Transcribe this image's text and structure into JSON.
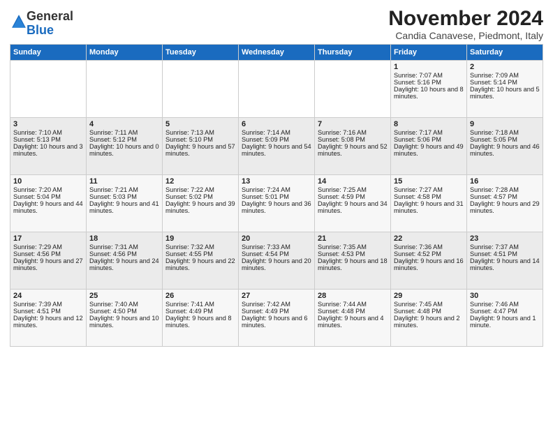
{
  "logo": {
    "general": "General",
    "blue": "Blue"
  },
  "title": "November 2024",
  "subtitle": "Candia Canavese, Piedmont, Italy",
  "weekdays": [
    "Sunday",
    "Monday",
    "Tuesday",
    "Wednesday",
    "Thursday",
    "Friday",
    "Saturday"
  ],
  "weeks": [
    [
      {
        "day": "",
        "info": ""
      },
      {
        "day": "",
        "info": ""
      },
      {
        "day": "",
        "info": ""
      },
      {
        "day": "",
        "info": ""
      },
      {
        "day": "",
        "info": ""
      },
      {
        "day": "1",
        "info": "Sunrise: 7:07 AM\nSunset: 5:16 PM\nDaylight: 10 hours and 8 minutes."
      },
      {
        "day": "2",
        "info": "Sunrise: 7:09 AM\nSunset: 5:14 PM\nDaylight: 10 hours and 5 minutes."
      }
    ],
    [
      {
        "day": "3",
        "info": "Sunrise: 7:10 AM\nSunset: 5:13 PM\nDaylight: 10 hours and 3 minutes."
      },
      {
        "day": "4",
        "info": "Sunrise: 7:11 AM\nSunset: 5:12 PM\nDaylight: 10 hours and 0 minutes."
      },
      {
        "day": "5",
        "info": "Sunrise: 7:13 AM\nSunset: 5:10 PM\nDaylight: 9 hours and 57 minutes."
      },
      {
        "day": "6",
        "info": "Sunrise: 7:14 AM\nSunset: 5:09 PM\nDaylight: 9 hours and 54 minutes."
      },
      {
        "day": "7",
        "info": "Sunrise: 7:16 AM\nSunset: 5:08 PM\nDaylight: 9 hours and 52 minutes."
      },
      {
        "day": "8",
        "info": "Sunrise: 7:17 AM\nSunset: 5:06 PM\nDaylight: 9 hours and 49 minutes."
      },
      {
        "day": "9",
        "info": "Sunrise: 7:18 AM\nSunset: 5:05 PM\nDaylight: 9 hours and 46 minutes."
      }
    ],
    [
      {
        "day": "10",
        "info": "Sunrise: 7:20 AM\nSunset: 5:04 PM\nDaylight: 9 hours and 44 minutes."
      },
      {
        "day": "11",
        "info": "Sunrise: 7:21 AM\nSunset: 5:03 PM\nDaylight: 9 hours and 41 minutes."
      },
      {
        "day": "12",
        "info": "Sunrise: 7:22 AM\nSunset: 5:02 PM\nDaylight: 9 hours and 39 minutes."
      },
      {
        "day": "13",
        "info": "Sunrise: 7:24 AM\nSunset: 5:01 PM\nDaylight: 9 hours and 36 minutes."
      },
      {
        "day": "14",
        "info": "Sunrise: 7:25 AM\nSunset: 4:59 PM\nDaylight: 9 hours and 34 minutes."
      },
      {
        "day": "15",
        "info": "Sunrise: 7:27 AM\nSunset: 4:58 PM\nDaylight: 9 hours and 31 minutes."
      },
      {
        "day": "16",
        "info": "Sunrise: 7:28 AM\nSunset: 4:57 PM\nDaylight: 9 hours and 29 minutes."
      }
    ],
    [
      {
        "day": "17",
        "info": "Sunrise: 7:29 AM\nSunset: 4:56 PM\nDaylight: 9 hours and 27 minutes."
      },
      {
        "day": "18",
        "info": "Sunrise: 7:31 AM\nSunset: 4:56 PM\nDaylight: 9 hours and 24 minutes."
      },
      {
        "day": "19",
        "info": "Sunrise: 7:32 AM\nSunset: 4:55 PM\nDaylight: 9 hours and 22 minutes."
      },
      {
        "day": "20",
        "info": "Sunrise: 7:33 AM\nSunset: 4:54 PM\nDaylight: 9 hours and 20 minutes."
      },
      {
        "day": "21",
        "info": "Sunrise: 7:35 AM\nSunset: 4:53 PM\nDaylight: 9 hours and 18 minutes."
      },
      {
        "day": "22",
        "info": "Sunrise: 7:36 AM\nSunset: 4:52 PM\nDaylight: 9 hours and 16 minutes."
      },
      {
        "day": "23",
        "info": "Sunrise: 7:37 AM\nSunset: 4:51 PM\nDaylight: 9 hours and 14 minutes."
      }
    ],
    [
      {
        "day": "24",
        "info": "Sunrise: 7:39 AM\nSunset: 4:51 PM\nDaylight: 9 hours and 12 minutes."
      },
      {
        "day": "25",
        "info": "Sunrise: 7:40 AM\nSunset: 4:50 PM\nDaylight: 9 hours and 10 minutes."
      },
      {
        "day": "26",
        "info": "Sunrise: 7:41 AM\nSunset: 4:49 PM\nDaylight: 9 hours and 8 minutes."
      },
      {
        "day": "27",
        "info": "Sunrise: 7:42 AM\nSunset: 4:49 PM\nDaylight: 9 hours and 6 minutes."
      },
      {
        "day": "28",
        "info": "Sunrise: 7:44 AM\nSunset: 4:48 PM\nDaylight: 9 hours and 4 minutes."
      },
      {
        "day": "29",
        "info": "Sunrise: 7:45 AM\nSunset: 4:48 PM\nDaylight: 9 hours and 2 minutes."
      },
      {
        "day": "30",
        "info": "Sunrise: 7:46 AM\nSunset: 4:47 PM\nDaylight: 9 hours and 1 minute."
      }
    ]
  ]
}
